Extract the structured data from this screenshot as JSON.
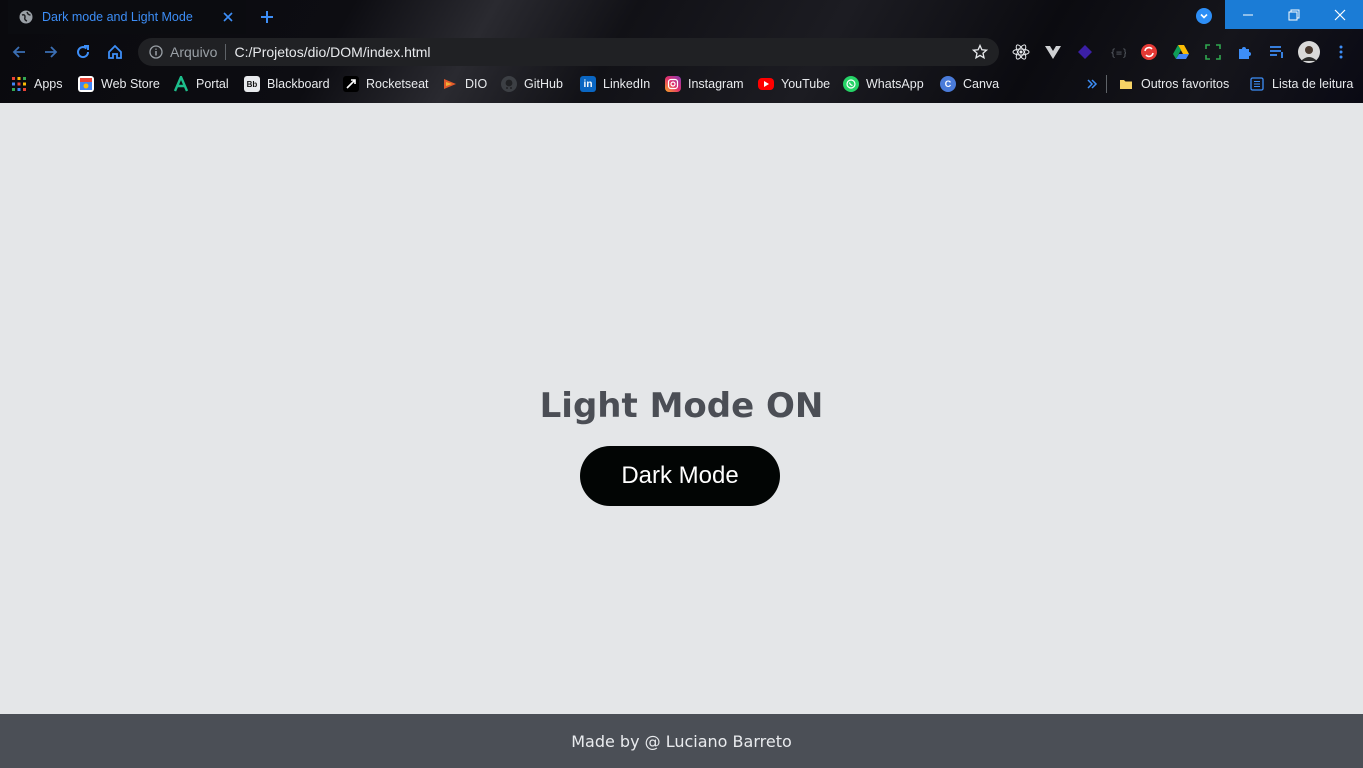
{
  "browser": {
    "tab": {
      "title": "Dark mode and Light Mode"
    },
    "omnibox": {
      "scheme_label": "Arquivo",
      "url": "C:/Projetos/dio/DOM/index.html"
    },
    "bookmarks": [
      {
        "label": "Apps",
        "icon": "apps-grid-icon"
      },
      {
        "label": "Web Store",
        "icon": "webstore-icon"
      },
      {
        "label": "Portal",
        "icon": "portal-icon"
      },
      {
        "label": "Blackboard",
        "icon": "blackboard-icon"
      },
      {
        "label": "Rocketseat",
        "icon": "rocketseat-icon"
      },
      {
        "label": "DIO",
        "icon": "dio-icon"
      },
      {
        "label": "GitHub",
        "icon": "github-icon"
      },
      {
        "label": "LinkedIn",
        "icon": "linkedin-icon"
      },
      {
        "label": "Instagram",
        "icon": "instagram-icon"
      },
      {
        "label": "YouTube",
        "icon": "youtube-icon"
      },
      {
        "label": "WhatsApp",
        "icon": "whatsapp-icon"
      },
      {
        "label": "Canva",
        "icon": "canva-icon"
      }
    ],
    "other_bookmarks": {
      "label": "Outros favoritos"
    },
    "reading_list": {
      "label": "Lista de leitura"
    },
    "accent_color": "#3d8ef7"
  },
  "page": {
    "title": "Light Mode ON",
    "button_label": "Dark Mode",
    "footer_text": "Made by @ Luciano Barreto",
    "background_color": "#e4e6e8",
    "footer_color": "#4b4f56"
  }
}
